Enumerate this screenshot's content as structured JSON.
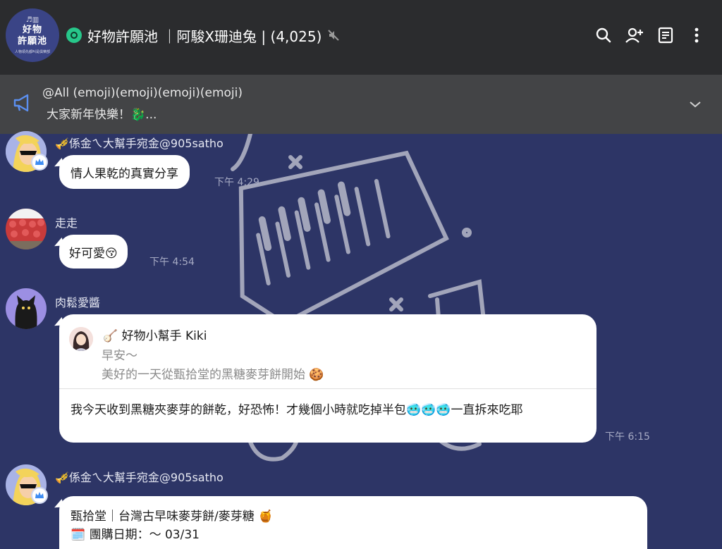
{
  "header": {
    "group_avatar": {
      "line1": "好物",
      "line2": "許願池",
      "sub": "人物領先都叫是俱樂部"
    },
    "title": "好物許願池 ｜阿駿X珊迪兔 | (4,025)",
    "icons": [
      "search-icon",
      "add-friend-icon",
      "notes-icon",
      "more-icon"
    ]
  },
  "announcement": {
    "line1": "@All (emoji)(emoji)(emoji)(emoji)",
    "line2": "大家新年快樂！🐉..."
  },
  "messages": [
    {
      "sender": "🎺係金ㄟ大幫手宛金@905satho",
      "text": "情人果乾的真實分享",
      "time": "下午 4:29"
    },
    {
      "sender": "走走",
      "text": "好可愛😚",
      "time": "下午 4:54"
    },
    {
      "sender": "肉鬆愛醬",
      "reply": {
        "name": "🪕 好物小幫手 Kiki",
        "line1": "早安～",
        "line2": "美好的一天從甄拾堂的黑糖麥芽餅開始 🍪"
      },
      "text": "我今天收到黑糖夾麥芽的餅乾，好恐怖！才幾個小時就吃掉半包🥶🥶🥶一直拆來吃耶",
      "time": "下午 6:15"
    },
    {
      "sender": "🎺係金ㄟ大幫手宛金@905satho",
      "line1": "甄拾堂｜台灣古早味麥芽餅/麥芽糖 🍯",
      "line2": "🗓️ 團購日期：～ 03/31"
    }
  ],
  "colors": {
    "chat_bg": "#2d3566",
    "header_bg": "#2b2c2e",
    "announce_bg": "#434446",
    "open_chat_green": "#27c78a"
  }
}
